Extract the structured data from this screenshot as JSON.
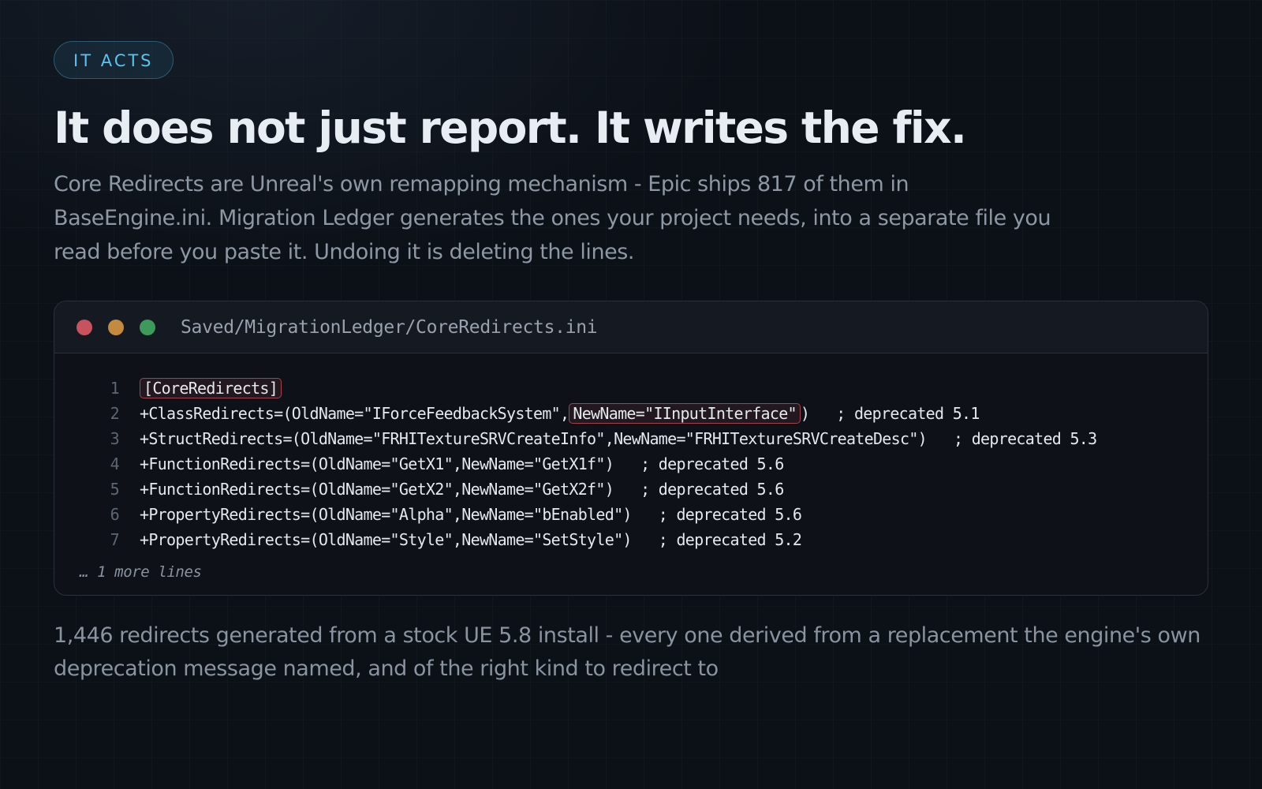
{
  "badge": "IT ACTS",
  "title": "It does not just report. It writes the fix.",
  "lede": "Core Redirects are Unreal's own remapping mechanism - Epic ships 817 of them in BaseEngine.ini. Migration Ledger generates the ones your project needs, into a separate file you read before you paste it. Undoing it is deleting the lines.",
  "window": {
    "file_path": "Saved/MigrationLedger/CoreRedirects.ini",
    "lines": [
      {
        "num": "1",
        "text": "[CoreRedirects]"
      },
      {
        "num": "2",
        "before": "+ClassRedirects=(OldName=\"IForceFeedbackSystem\",",
        "highlight": "NewName=\"IInputInterface\"",
        "after": ")   ; deprecated 5.1"
      },
      {
        "num": "3",
        "text": "+StructRedirects=(OldName=\"FRHITextureSRVCreateInfo\",NewName=\"FRHITextureSRVCreateDesc\")   ; deprecated 5.3"
      },
      {
        "num": "4",
        "text": "+FunctionRedirects=(OldName=\"GetX1\",NewName=\"GetX1f\")   ; deprecated 5.6"
      },
      {
        "num": "5",
        "text": "+FunctionRedirects=(OldName=\"GetX2\",NewName=\"GetX2f\")   ; deprecated 5.6"
      },
      {
        "num": "6",
        "text": "+PropertyRedirects=(OldName=\"Alpha\",NewName=\"bEnabled\")   ; deprecated 5.6"
      },
      {
        "num": "7",
        "text": "+PropertyRedirects=(OldName=\"Style\",NewName=\"SetStyle\")   ; deprecated 5.2"
      }
    ],
    "more_lines": "… 1 more lines"
  },
  "footer": "1,446 redirects generated from a stock UE 5.8 install - every one derived from a replacement the engine's own deprecation message named, and of the right kind to redirect to"
}
